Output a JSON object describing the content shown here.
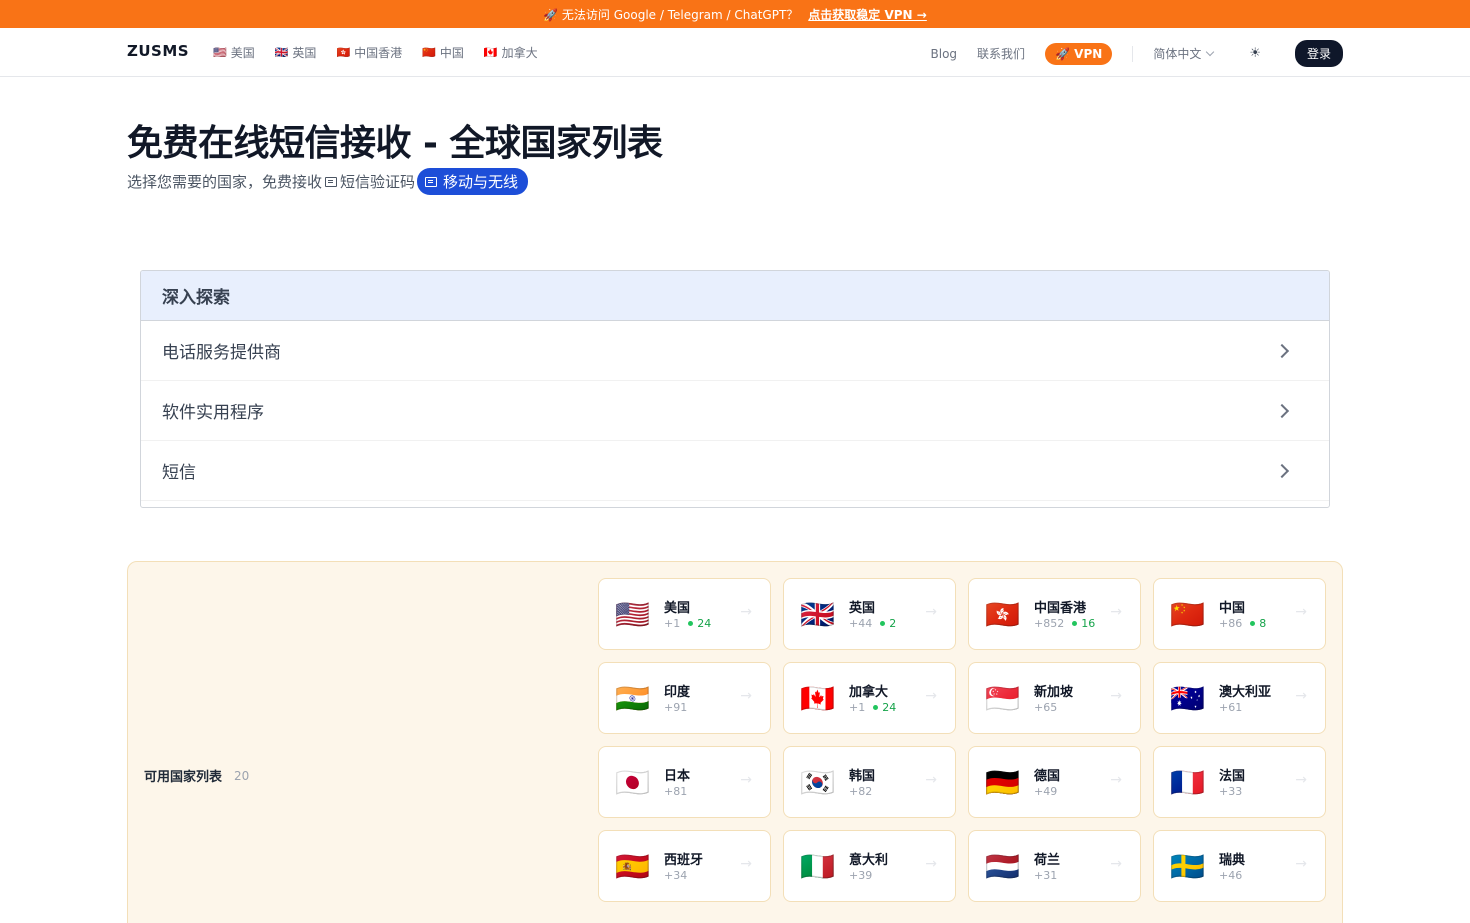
{
  "banner": {
    "text": "🚀 无法访问 Google / Telegram / ChatGPT？",
    "cta": "点击获取稳定 VPN →"
  },
  "navbar": {
    "logo": "ZUSMS",
    "quick_links": [
      {
        "flag": "🇺🇸",
        "label": "美国"
      },
      {
        "flag": "🇬🇧",
        "label": "英国"
      },
      {
        "flag": "🇭🇰",
        "label": "中国香港"
      },
      {
        "flag": "🇨🇳",
        "label": "中国"
      },
      {
        "flag": "🇨🇦",
        "label": "加拿大"
      }
    ],
    "blog": "Blog",
    "contact": "联系我们",
    "vpn": "🚀 VPN",
    "language": "简体中文",
    "theme_icon": "☀",
    "login": "登录"
  },
  "header": {
    "title": "免费在线短信接收 - 全球国家列表",
    "subtitle_prefix": "选择您需要的国家，免费接收",
    "subtitle_mid": "短信验证码",
    "tag": "移动与无线"
  },
  "explore": {
    "title": "深入探索",
    "items": [
      "电话服务提供商",
      "软件实用程序",
      "短信"
    ]
  },
  "countries": {
    "label": "可用国家列表",
    "count": "20",
    "arrow": "→",
    "items": [
      {
        "flag": "🇺🇸",
        "name": "美国",
        "code": "+1",
        "online": "24"
      },
      {
        "flag": "🇬🇧",
        "name": "英国",
        "code": "+44",
        "online": "2"
      },
      {
        "flag": "🇭🇰",
        "name": "中国香港",
        "code": "+852",
        "online": "16"
      },
      {
        "flag": "🇨🇳",
        "name": "中国",
        "code": "+86",
        "online": "8"
      },
      {
        "flag": "🇮🇳",
        "name": "印度",
        "code": "+91",
        "online": ""
      },
      {
        "flag": "🇨🇦",
        "name": "加拿大",
        "code": "+1",
        "online": "24"
      },
      {
        "flag": "🇸🇬",
        "name": "新加坡",
        "code": "+65",
        "online": ""
      },
      {
        "flag": "🇦🇺",
        "name": "澳大利亚",
        "code": "+61",
        "online": ""
      },
      {
        "flag": "🇯🇵",
        "name": "日本",
        "code": "+81",
        "online": ""
      },
      {
        "flag": "🇰🇷",
        "name": "韩国",
        "code": "+82",
        "online": ""
      },
      {
        "flag": "🇩🇪",
        "name": "德国",
        "code": "+49",
        "online": ""
      },
      {
        "flag": "🇫🇷",
        "name": "法国",
        "code": "+33",
        "online": ""
      },
      {
        "flag": "🇪🇸",
        "name": "西班牙",
        "code": "+34",
        "online": ""
      },
      {
        "flag": "🇮🇹",
        "name": "意大利",
        "code": "+39",
        "online": ""
      },
      {
        "flag": "🇳🇱",
        "name": "荷兰",
        "code": "+31",
        "online": ""
      },
      {
        "flag": "🇸🇪",
        "name": "瑞典",
        "code": "+46",
        "online": ""
      }
    ]
  }
}
